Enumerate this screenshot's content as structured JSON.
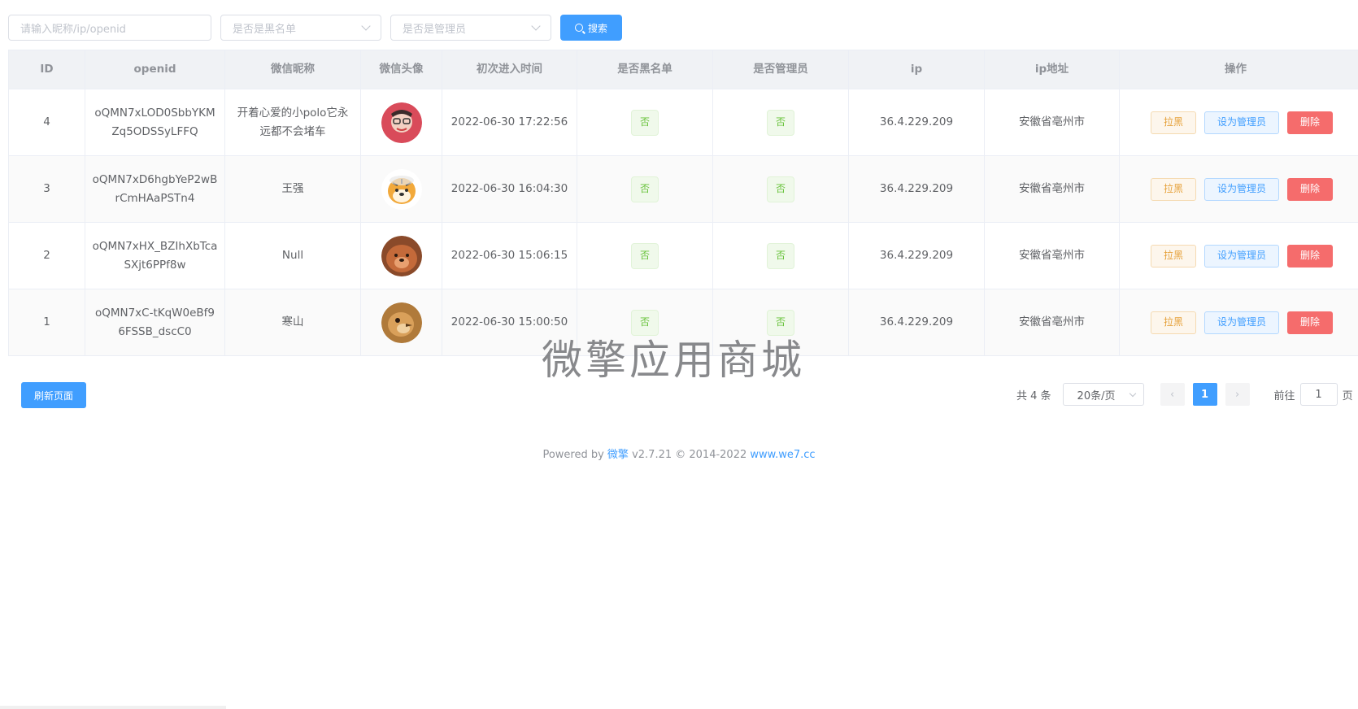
{
  "filters": {
    "search_placeholder": "请输入昵称/ip/openid",
    "blacklist_placeholder": "是否是黑名单",
    "admin_placeholder": "是否是管理员",
    "search_button": "搜索"
  },
  "table": {
    "headers": [
      "ID",
      "openid",
      "微信昵称",
      "微信头像",
      "初次进入时间",
      "是否黑名单",
      "是否管理员",
      "ip",
      "ip地址",
      "操作"
    ],
    "rows": [
      {
        "id": "4",
        "openid": "oQMN7xLOD0SbbYKMZq5ODSSyLFFQ",
        "nickname": "开着心爱的小polo它永远都不会堵车",
        "avatar": "avatar-child",
        "time": "2022-06-30 17:22:56",
        "blacklist": "否",
        "admin": "否",
        "ip": "36.4.229.209",
        "address": "安徽省亳州市"
      },
      {
        "id": "3",
        "openid": "oQMN7xD6hgbYeP2wBrCmHAaPSTn4",
        "nickname": "王强",
        "avatar": "avatar-tiger",
        "time": "2022-06-30 16:04:30",
        "blacklist": "否",
        "admin": "否",
        "ip": "36.4.229.209",
        "address": "安徽省亳州市"
      },
      {
        "id": "2",
        "openid": "oQMN7xHX_BZIhXbTcaSXjt6PPf8w",
        "nickname": "Null",
        "avatar": "avatar-dog",
        "time": "2022-06-30 15:06:15",
        "blacklist": "否",
        "admin": "否",
        "ip": "36.4.229.209",
        "address": "安徽省亳州市"
      },
      {
        "id": "1",
        "openid": "oQMN7xC-tKqW0eBf96FSSB_dscC0",
        "nickname": "寒山",
        "avatar": "avatar-bird",
        "time": "2022-06-30 15:00:50",
        "blacklist": "否",
        "admin": "否",
        "ip": "36.4.229.209",
        "address": "安徽省亳州市"
      }
    ],
    "actions": {
      "blacklist": "拉黑",
      "set_admin": "设为管理员",
      "delete": "删除"
    }
  },
  "watermark": "微擎应用商城",
  "refresh_button": "刷新页面",
  "pagination": {
    "total": "共 4 条",
    "page_size": "20条/页",
    "prev": "‹",
    "current": "1",
    "next": "›",
    "goto_label": "前往",
    "goto_value": "1",
    "goto_suffix": "页"
  },
  "footer": {
    "powered": "Powered by ",
    "brand": "微擎",
    "version": " v2.7.21 © 2014-2022 ",
    "url": "www.we7.cc"
  },
  "colors": {
    "primary": "#409eff",
    "success": "#67c23a",
    "warning": "#e6a23c",
    "danger": "#f56c6c"
  }
}
